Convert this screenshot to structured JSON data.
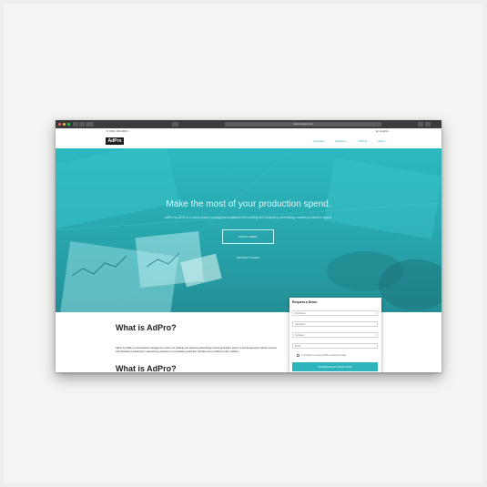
{
  "browser": {
    "url": "adprocomplex.com"
  },
  "topbar": {
    "phone": "(000) 000-0000",
    "language": "English"
  },
  "header": {
    "logo_text": "AdPro",
    "nav": [
      "Overview",
      "Solutions",
      "Pricing",
      "About"
    ]
  },
  "hero": {
    "title": "Make the most of your production spend.",
    "subtitle": "AdPro by ARM is a cloud-based management platform for tracking and analyzing advertising content production spend.",
    "watch_button": "WATCH DEMO",
    "contact_link": "CONTACT SALES ›"
  },
  "content": {
    "heading": "What is AdPro?",
    "paragraph": "AdPro by ARM is a cloud-based management system for tracking and analyzing advertising content production spend. It was designed by industry experts with decades of leadership in advertising production to consolidate production activities into an efficient online platform.",
    "heading2": "What is AdPro?"
  },
  "form": {
    "title": "Request a Demo",
    "fields": [
      "First Name",
      "Last Name",
      "Company",
      "Email"
    ],
    "checkbox_label": "I would like to receive ARM's marketing emails",
    "submit": "SCHEDULE MY DEMO NOW"
  },
  "colors": {
    "accent": "#2db8bf",
    "chrome": "#3b3b3d"
  }
}
